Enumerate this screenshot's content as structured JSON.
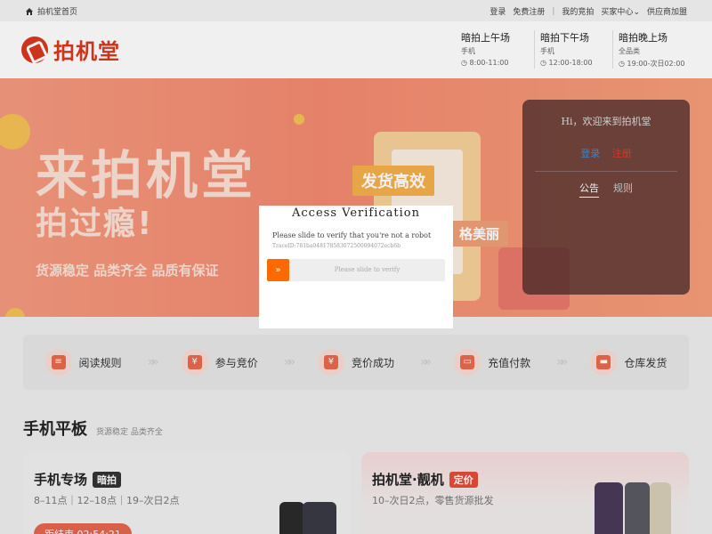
{
  "topbar": {
    "home_label": "拍机堂首页",
    "login": "登录",
    "register": "免费注册",
    "separator": "|",
    "my_bids": "我的竞拍",
    "buyer_center": "买家中心",
    "supplier_join": "供应商加盟"
  },
  "header": {
    "logo_text": "拍机堂",
    "sessions": [
      {
        "title": "暗拍上午场",
        "sub": "手机",
        "time": "8:00-11:00"
      },
      {
        "title": "暗拍下午场",
        "sub": "手机",
        "time": "12:00-18:00"
      },
      {
        "title": "暗拍晚上场",
        "sub": "全品类",
        "time": "19:00-次日02:00"
      }
    ]
  },
  "banner": {
    "headline": "来拍机堂",
    "subheadline": "拍过瘾!",
    "tagline": "货源稳定 品类齐全 品质有保证",
    "tag1": "发货高效",
    "tag2": "格美丽"
  },
  "welcome": {
    "greeting": "Hi，欢迎来到拍机堂",
    "login": "登录",
    "register": "注册",
    "tab_notice": "公告",
    "tab_rules": "规则"
  },
  "steps": [
    {
      "label": "阅读规则",
      "icon": "scroll-icon"
    },
    {
      "label": "参与竞价",
      "icon": "bid-icon"
    },
    {
      "label": "竞价成功",
      "icon": "success-icon"
    },
    {
      "label": "充值付款",
      "icon": "card-icon"
    },
    {
      "label": "仓库发货",
      "icon": "box-icon"
    }
  ],
  "section": {
    "title": "手机平板",
    "subtitle": "货源稳定 品类齐全"
  },
  "cards": [
    {
      "title": "手机专场",
      "badge": "暗拍",
      "sub": "8–11点｜12–18点｜19–次日2点",
      "button": "距结束 02:54:21"
    },
    {
      "title": "拍机堂·靓机",
      "badge": "定价",
      "sub": "10–次日2点，零售货源批发"
    }
  ],
  "modal": {
    "title": "Access Verification",
    "description": "Please slide to verify that you're not a robot",
    "trace": "TraceID:781ba048178583072500094072ecb6b",
    "slider_text": "Please slide to verify",
    "handle_glyph": "»"
  },
  "colors": {
    "brand": "#d9381e",
    "slider_handle": "#ff6a00",
    "login_link": "#3c8fd6",
    "register_link": "#e23b2a"
  }
}
